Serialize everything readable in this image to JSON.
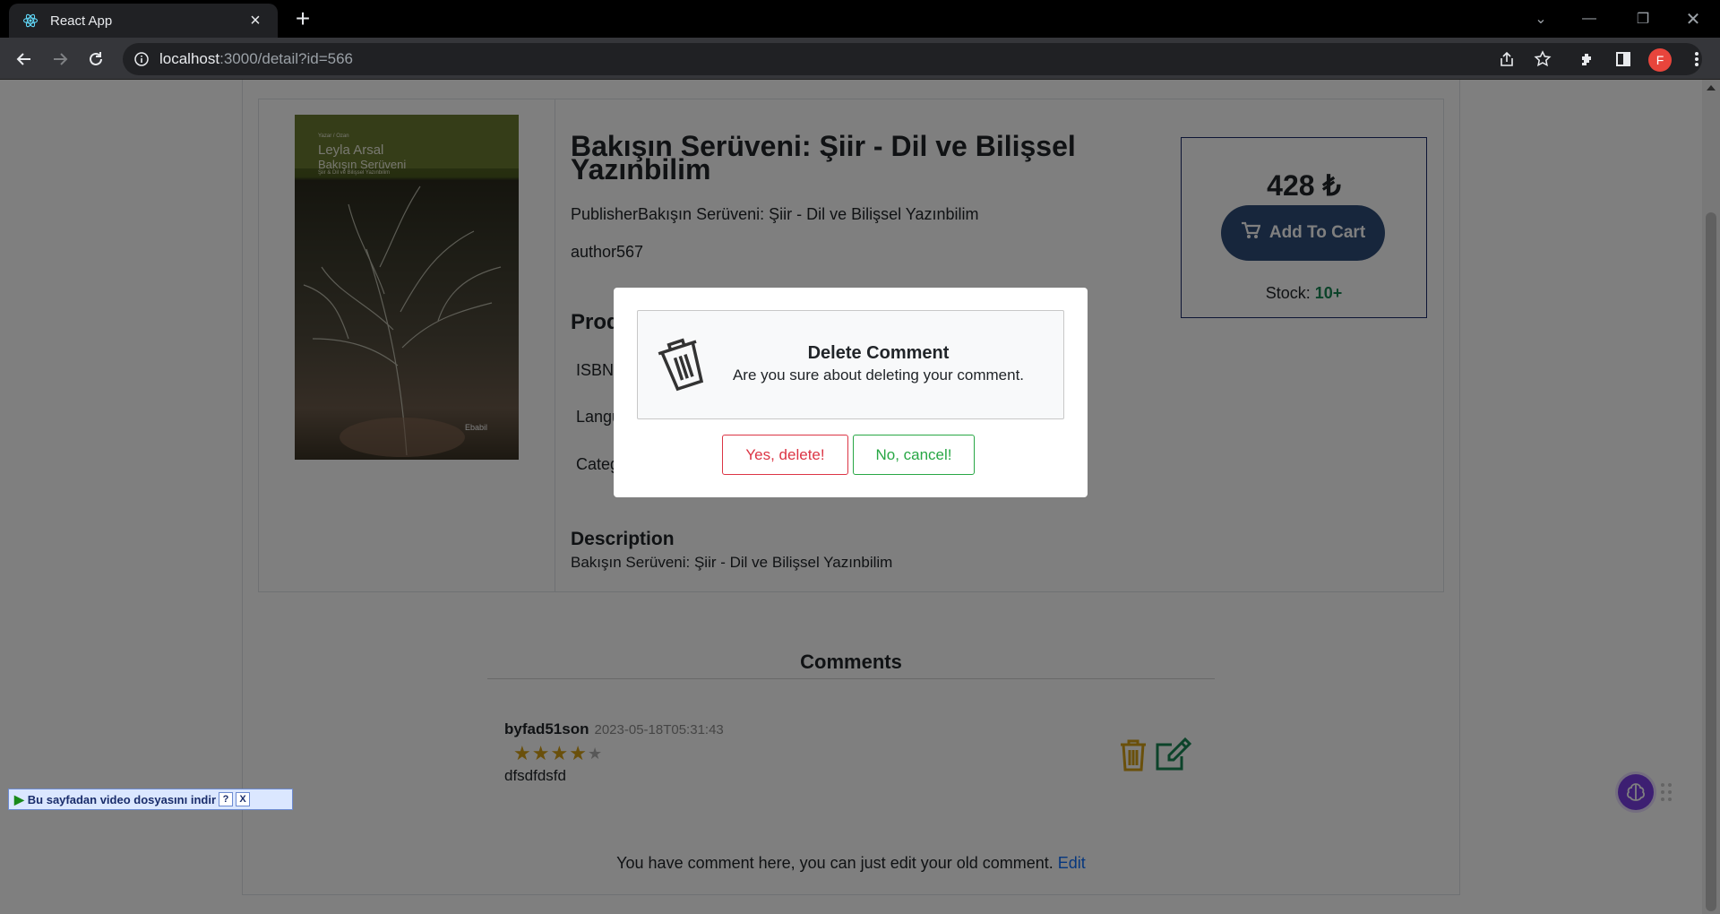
{
  "browser": {
    "tab_title": "React App",
    "url_host": "localhost",
    "url_rest": ":3000/detail?id=566",
    "avatar_letter": "F"
  },
  "product": {
    "cover": {
      "author_small": "Yazar / Ozan",
      "author": "Leyla Arsal",
      "title": "Bakışın Serüveni",
      "subtitle": "Şiir & Dil ve Bilişsel Yazınbilim",
      "publisher": "Ebabil"
    },
    "title": "Bakışın Serüveni: Şiir - Dil ve Bilişsel Yazınbilim",
    "publisher_line": "PublisherBakışın Serüveni: Şiir - Dil ve Bilişsel Yazınbilim",
    "author": "author567",
    "product_heading": "Prod",
    "isbn_label": "ISBN:",
    "language_label": "Langu",
    "category_label": "Categ",
    "description_heading": "Description",
    "description": "Bakışın Serüveni: Şiir - Dil ve Bilişsel Yazınbilim",
    "price": "428 ₺",
    "add_to_cart": "Add To Cart",
    "stock_label": "Stock: ",
    "stock_value": "10+"
  },
  "comments": {
    "heading": "Comments",
    "items": [
      {
        "user": "byfad51son",
        "date": "2023-05-18T05:31:43",
        "rating": 4,
        "max_rating": 5,
        "text": "dfsdfdsfd"
      }
    ],
    "note": "You have comment here, you can just edit your old comment. ",
    "edit_link": "Edit"
  },
  "download_bar": {
    "text": "Bu sayfadan video dosyasını indir",
    "help": "?",
    "close": "X"
  },
  "modal": {
    "title": "Delete Comment",
    "message": "Are you sure about deleting your comment.",
    "yes": "Yes, delete!",
    "no": "No, cancel!"
  },
  "colors": {
    "accent_blue": "#2e4c78",
    "danger": "#dc3545",
    "success": "#28a745",
    "star": "#d4a017",
    "trash_icon": "#d4a017",
    "edit_icon": "#198754"
  }
}
